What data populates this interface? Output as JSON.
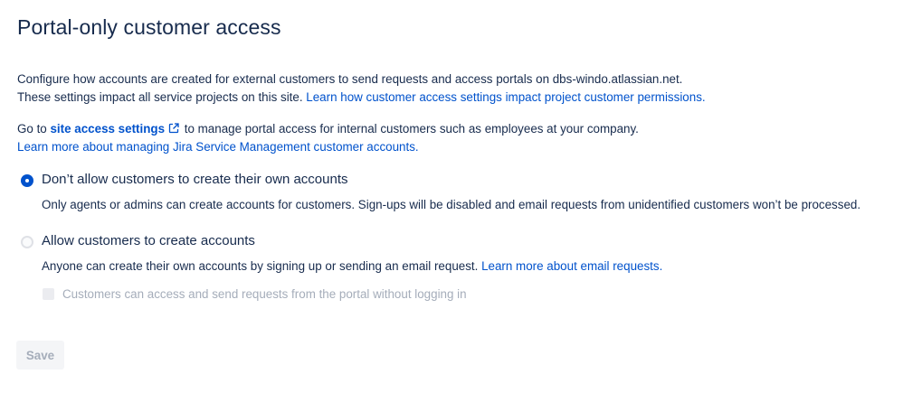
{
  "page": {
    "title": "Portal-only customer access"
  },
  "intro": {
    "line1": "Configure how accounts are created for external customers to send requests and access portals on dbs-windo.atlassian.net.",
    "line2_text": "These settings impact all service projects on this site. ",
    "line2_link": "Learn how customer access settings impact project customer permissions."
  },
  "site_access": {
    "prefix": "Go to ",
    "link": "site access settings",
    "icon": "external-link-icon",
    "suffix": " to manage portal access for internal customers such as employees at your company.",
    "learn_more_link": "Learn more about managing Jira Service Management customer accounts."
  },
  "options": [
    {
      "label": "Don’t allow customers to create their own accounts",
      "description": "Only agents or admins can create accounts for customers. Sign-ups will be disabled and email requests from unidentified customers won’t be processed.",
      "selected": true
    },
    {
      "label": "Allow customers to create accounts",
      "description": "Anyone can create their own accounts by signing up or sending an email request. ",
      "description_link": "Learn more about email requests.",
      "selected": false
    }
  ],
  "checkbox": {
    "label": "Customers can access and send requests from the portal without logging in",
    "checked": false,
    "disabled": true
  },
  "actions": {
    "save_label": "Save"
  },
  "colors": {
    "text": "#172b4d",
    "link": "#0052cc",
    "radio_selected": "#0052cc",
    "disabled_text": "#a5adba",
    "disabled_bg": "#f4f5f7"
  }
}
